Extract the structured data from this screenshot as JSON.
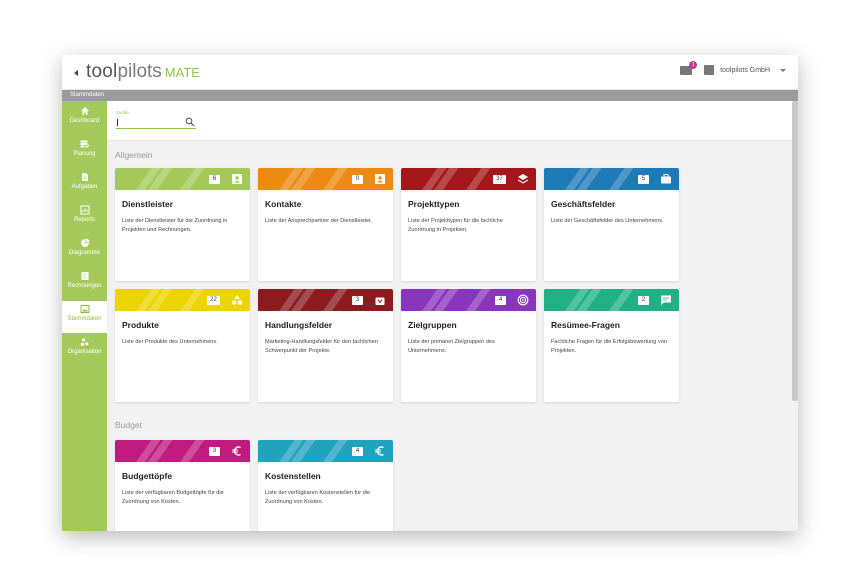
{
  "app": {
    "logo_part1": "tool",
    "logo_part2": "pilots",
    "logo_suffix": "MATE",
    "company": "toolpilots GmbH",
    "mail_badge": "1"
  },
  "breadcrumb": "Stammdaten",
  "sidebar": {
    "items": [
      {
        "label": "Dashboard",
        "icon": "home-icon"
      },
      {
        "label": "Planung",
        "icon": "list-check-icon"
      },
      {
        "label": "Aufgaben",
        "icon": "document-icon"
      },
      {
        "label": "Reports",
        "icon": "chart-box-icon"
      },
      {
        "label": "Diagramme",
        "icon": "pie-chart-icon"
      },
      {
        "label": "Rechnungen",
        "icon": "invoice-icon"
      },
      {
        "label": "Stammdaten",
        "icon": "image-box-icon",
        "active": true
      },
      {
        "label": "Organisation",
        "icon": "org-icon"
      }
    ]
  },
  "search": {
    "label": "Suche",
    "value": ""
  },
  "sections": {
    "allgemein": "Allgemein",
    "budget": "Budget"
  },
  "cards": [
    {
      "title": "Dienstleister",
      "count": "6",
      "color": "#a3c95b",
      "icon": "contact-card-icon",
      "desc": "Liste der Dienstleister für die Zuordnung in Projekten und Rechnungen."
    },
    {
      "title": "Kontakte",
      "count": "0",
      "color": "#ec8a12",
      "icon": "contact-card-icon",
      "desc": "Liste der Ansprechpartner der Dienstleister."
    },
    {
      "title": "Projekttypen",
      "count": "37",
      "color": "#a3181a",
      "icon": "layers-icon",
      "desc": "Liste der Projekttypen für die fachliche Zuordnung in Projekten."
    },
    {
      "title": "Geschäftsfelder",
      "count": "5",
      "color": "#1f7ab8",
      "icon": "briefcase-icon",
      "desc": "Liste der Geschäftsfelder des Unternehmens."
    },
    {
      "title": "Produkte",
      "count": "22",
      "color": "#ecd400",
      "icon": "shapes-icon",
      "desc": "Liste der Produkte des Unternehmens."
    },
    {
      "title": "Handlungsfelder",
      "count": "3",
      "color": "#8a1b1f",
      "icon": "gift-icon",
      "desc": "Marketing-Handlungsfelder für den fachlichen Schwerpunkt der Projekte."
    },
    {
      "title": "Zielgruppen",
      "count": "4",
      "color": "#8a35bd",
      "icon": "target-icon",
      "desc": "Liste der primären Zielgruppen des Unternehmens."
    },
    {
      "title": "Resümee-Fragen",
      "count": "2",
      "color": "#22b184",
      "icon": "chat-icon",
      "desc": "Fachliche Fragen für die Erfolgsbewertung von Projekten."
    },
    {
      "title": "Budgettöpfe",
      "count": "3",
      "color": "#c01b7e",
      "icon": "euro-icon",
      "desc": "Liste der verfügbaren Budgettöpfe für die Zuordnung von Kosten."
    },
    {
      "title": "Kostenstellen",
      "count": "4",
      "color": "#21a2bd",
      "icon": "euro-icon",
      "desc": "Liste der verfügbaren Kostenstellen für die Zuordnung von Kosten."
    }
  ]
}
